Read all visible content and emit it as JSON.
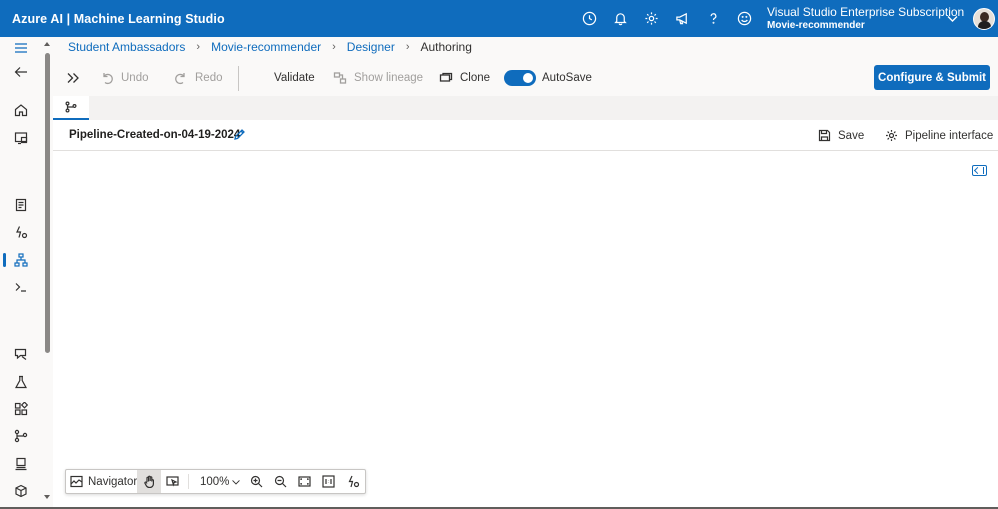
{
  "topbar": {
    "app_title": "Azure AI | Machine Learning Studio",
    "icons": [
      "clock-icon",
      "bell-icon",
      "gear-icon",
      "megaphone-icon",
      "help-icon",
      "smiley-icon"
    ],
    "subscription_name": "Visual Studio Enterprise Subscription",
    "workspace_name": "Movie-recommender",
    "brand_color": "#0f6cbd"
  },
  "breadcrumb": {
    "items": [
      "Student Ambassadors",
      "Movie-recommender",
      "Designer"
    ],
    "current": "Authoring"
  },
  "toolbar": {
    "undo_label": "Undo",
    "redo_label": "Redo",
    "validate_label": "Validate",
    "show_lineage_label": "Show lineage",
    "clone_label": "Clone",
    "autosave_label": "AutoSave",
    "autosave_on": true,
    "configure_label": "Configure & Submit"
  },
  "pipeline": {
    "name": "Pipeline-Created-on-04-19-2024",
    "save_label": "Save",
    "interface_label": "Pipeline interface"
  },
  "navigator": {
    "label": "Navigator",
    "zoom": "100%"
  }
}
